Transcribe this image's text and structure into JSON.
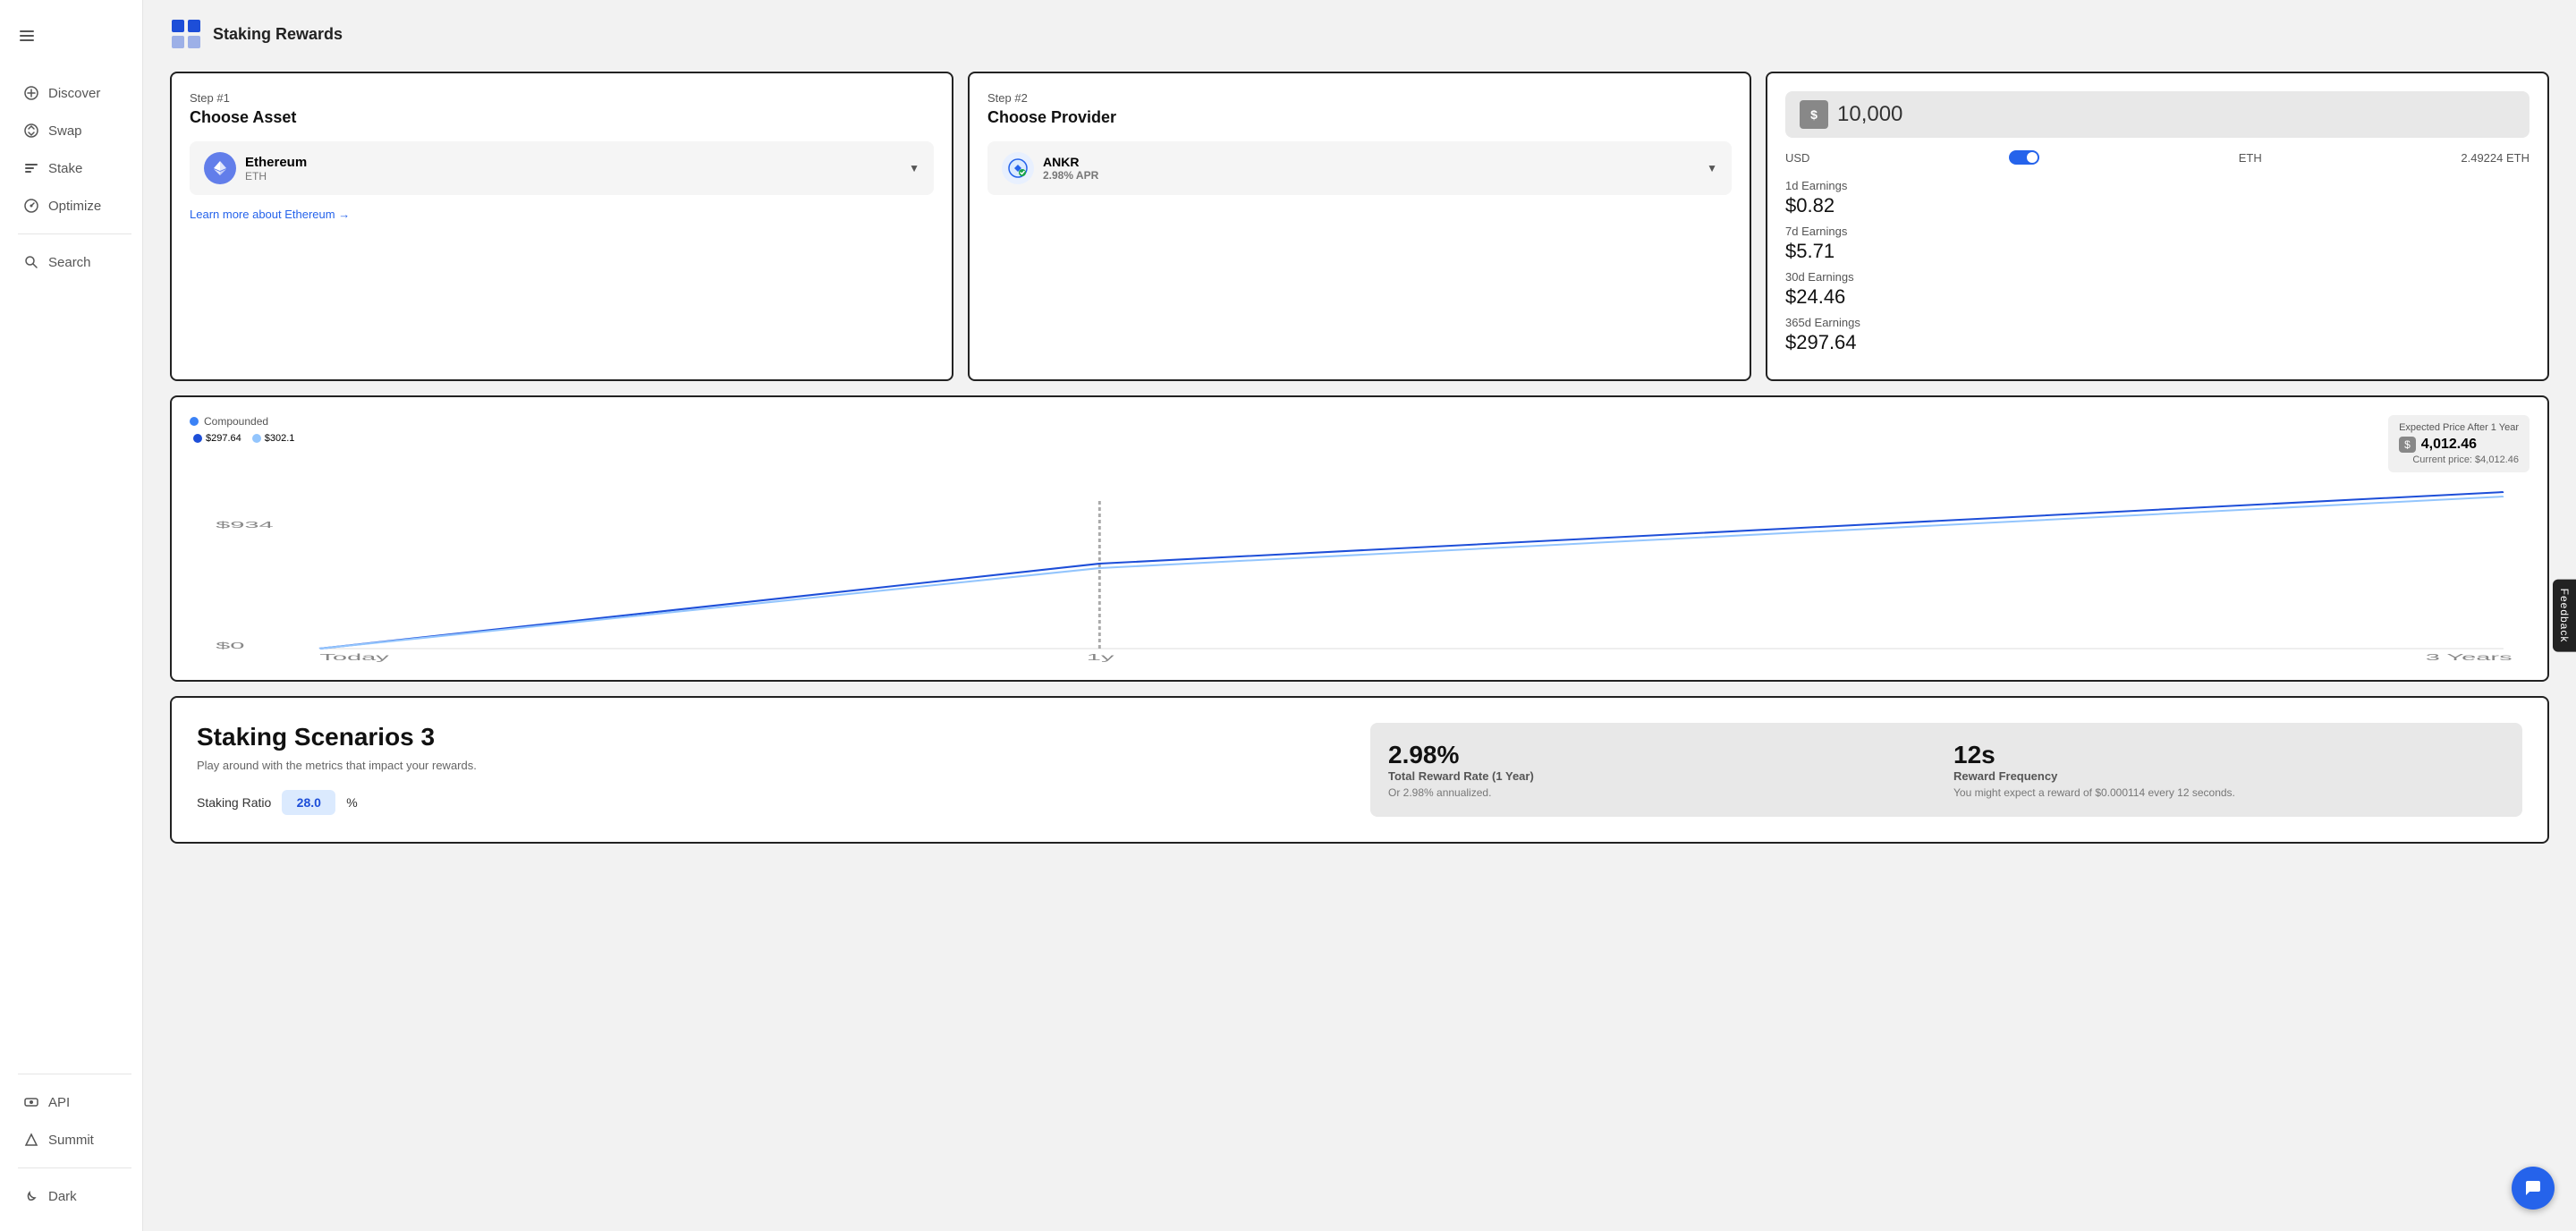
{
  "app": {
    "title": "Staking Rewards",
    "logo_alt": "Staking Rewards Logo"
  },
  "sidebar": {
    "toggle_label": "Toggle sidebar",
    "items": [
      {
        "id": "discover",
        "label": "Discover",
        "icon": "discover-icon"
      },
      {
        "id": "swap",
        "label": "Swap",
        "icon": "swap-icon"
      },
      {
        "id": "stake",
        "label": "Stake",
        "icon": "stake-icon"
      },
      {
        "id": "optimize",
        "label": "Optimize",
        "icon": "optimize-icon"
      },
      {
        "id": "search",
        "label": "Search",
        "icon": "search-icon"
      }
    ],
    "bottom_items": [
      {
        "id": "api",
        "label": "API",
        "icon": "api-icon"
      },
      {
        "id": "summit",
        "label": "Summit",
        "icon": "summit-icon"
      },
      {
        "id": "dark",
        "label": "Dark",
        "icon": "dark-icon"
      }
    ]
  },
  "step1": {
    "step_label": "Step #1",
    "step_title": "Choose Asset",
    "asset_name": "Ethereum",
    "asset_ticker": "ETH",
    "learn_more": "Learn more about Ethereum →"
  },
  "step2": {
    "step_label": "Step #2",
    "step_title": "Choose Provider",
    "provider_name": "ANKR",
    "provider_apr": "2.98% APR"
  },
  "calculator": {
    "amount": "10,000",
    "currency_left": "USD",
    "currency_right": "ETH",
    "eth_equivalent": "2.49224 ETH",
    "earnings_1d_label": "1d Earnings",
    "earnings_1d": "$0.82",
    "earnings_7d_label": "7d Earnings",
    "earnings_7d": "$5.71",
    "earnings_30d_label": "30d Earnings",
    "earnings_30d": "$24.46",
    "earnings_365d_label": "365d Earnings",
    "earnings_365d": "$297.64"
  },
  "chart": {
    "compounded_label": "Compounded",
    "expected_price_label": "Expected Price After 1 Year",
    "expected_price_value": "4,012.46",
    "current_price_text": "Current price: $4,012.46",
    "legend_1_label": "$297.64",
    "legend_2_label": "$302.1",
    "y_start": "$0",
    "y_mid": "$934",
    "x_start": "Today",
    "x_mid": "1y",
    "x_end": "3 Years"
  },
  "scenarios": {
    "title": "Staking Scenarios 3",
    "description": "Play around with the metrics that impact your rewards.",
    "staking_ratio_label": "Staking Ratio",
    "staking_ratio_value": "28.0",
    "staking_ratio_unit": "%",
    "metric1_value": "2.98%",
    "metric1_label": "Total Reward Rate (1 Year)",
    "metric1_sublabel": "Or 2.98% annualized.",
    "metric2_value": "12s",
    "metric2_label": "Reward Frequency",
    "metric2_sublabel": "You might expect a reward of $0.000114 every 12 seconds."
  },
  "feedback": {
    "label": "Feedback"
  },
  "chat": {
    "icon": "💬"
  }
}
